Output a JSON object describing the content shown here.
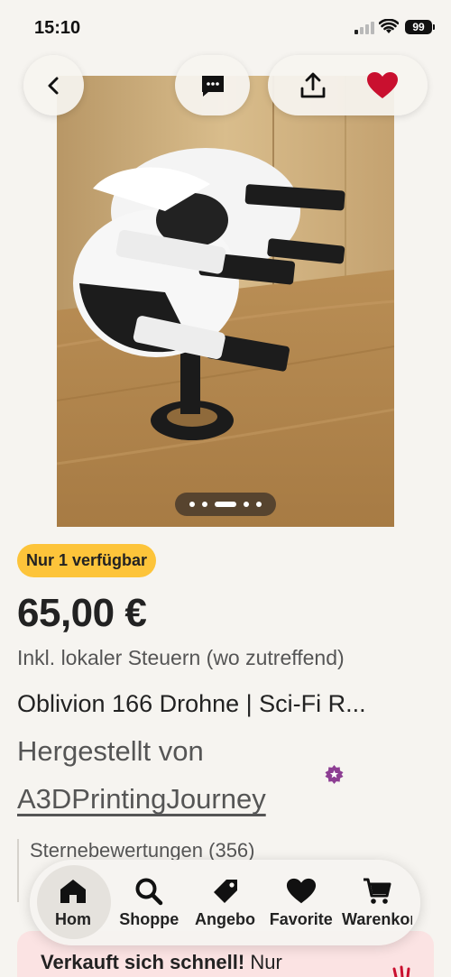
{
  "status": {
    "time": "15:10",
    "battery": "99"
  },
  "top_actions": {
    "back": "back-arrow-icon",
    "message": "message-icon",
    "share": "share-icon",
    "favorite": "heart-icon",
    "favorite_color": "#c9102f"
  },
  "gallery": {
    "image_count": 5,
    "active_index": 2
  },
  "listing": {
    "availability_badge": "Nur 1 verfügbar",
    "price": "65,00 €",
    "tax_note": "Inkl. lokaler Steuern (wo zutreffend)",
    "title": "Oblivion 166 Drohne | Sci-Fi R...",
    "made_by": "Hergestellt von",
    "shop_name": "A3DPrintingJourney",
    "star_seller_color": "#8d3e93"
  },
  "reviews": {
    "label": "Sternebewertungen (356)"
  },
  "promo": {
    "bold": "Verkauft sich schnell!",
    "text": " Nur"
  },
  "tabbar": {
    "tabs": [
      {
        "label": "Hom",
        "icon": "home-icon",
        "active": true
      },
      {
        "label": "Shoppe",
        "icon": "search-icon",
        "active": false
      },
      {
        "label": "Angebo",
        "icon": "tag-icon",
        "active": false
      },
      {
        "label": "Favorite",
        "icon": "heart-icon",
        "active": false
      },
      {
        "label": "Warenkor",
        "icon": "cart-icon",
        "active": false
      }
    ]
  },
  "colors": {
    "background": "#f6f4f0",
    "badge": "#fdc43a",
    "promo_bg": "#fbe3e3"
  }
}
